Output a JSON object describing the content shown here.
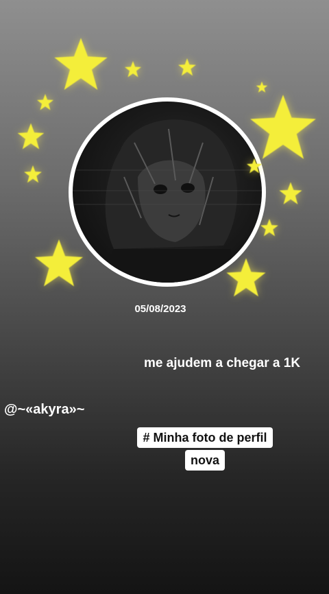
{
  "post": {
    "date": "05/08/2023",
    "caption": "me ajudem a chegar a 1K",
    "username": "@~«akyra»~",
    "hashtag": "# Minha foto de perfil nova"
  },
  "colors": {
    "star": "#f4ee3a",
    "ring": "#ffffff",
    "text": "#ffffff"
  }
}
